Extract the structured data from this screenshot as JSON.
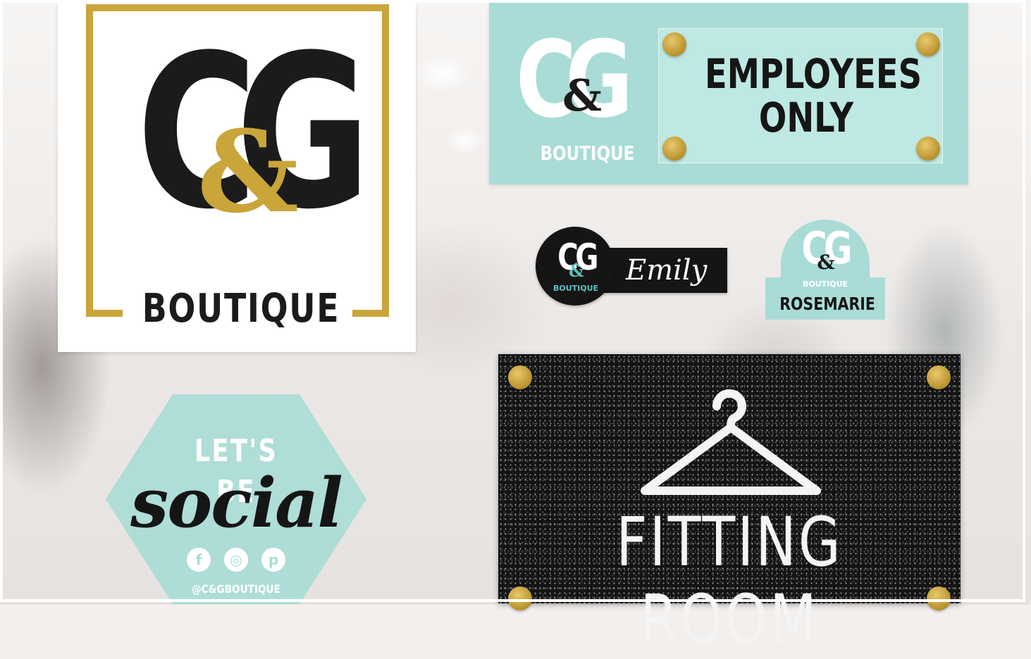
{
  "main_sign": {
    "monogram": "CG",
    "ampersand": "&",
    "boutique": "BOUTIQUE"
  },
  "employees_sign": {
    "monogram": "CG",
    "ampersand": "&",
    "boutique": "BOUTIQUE",
    "text": "EMPLOYEES ONLY"
  },
  "emily_badge": {
    "monogram": "CG",
    "ampersand": "&",
    "boutique": "BOUTIQUE",
    "name": "Emily"
  },
  "rosemarie_badge": {
    "monogram": "CG",
    "ampersand": "&",
    "boutique": "BOUTIQUE",
    "name": "ROSEMARIE"
  },
  "social_sign": {
    "top": "LET'S BE",
    "script": "social",
    "icons": [
      "facebook-icon",
      "instagram-icon",
      "pinterest-icon"
    ],
    "handle": "@C&GBOUTIQUE"
  },
  "fitting_sign": {
    "icon": "hanger-icon",
    "text": "FITTING ROOM"
  },
  "colors": {
    "mint": "#a9dcd7",
    "gold": "#c9a53a",
    "black": "#151515",
    "teal_accent": "#5ec1c2"
  }
}
